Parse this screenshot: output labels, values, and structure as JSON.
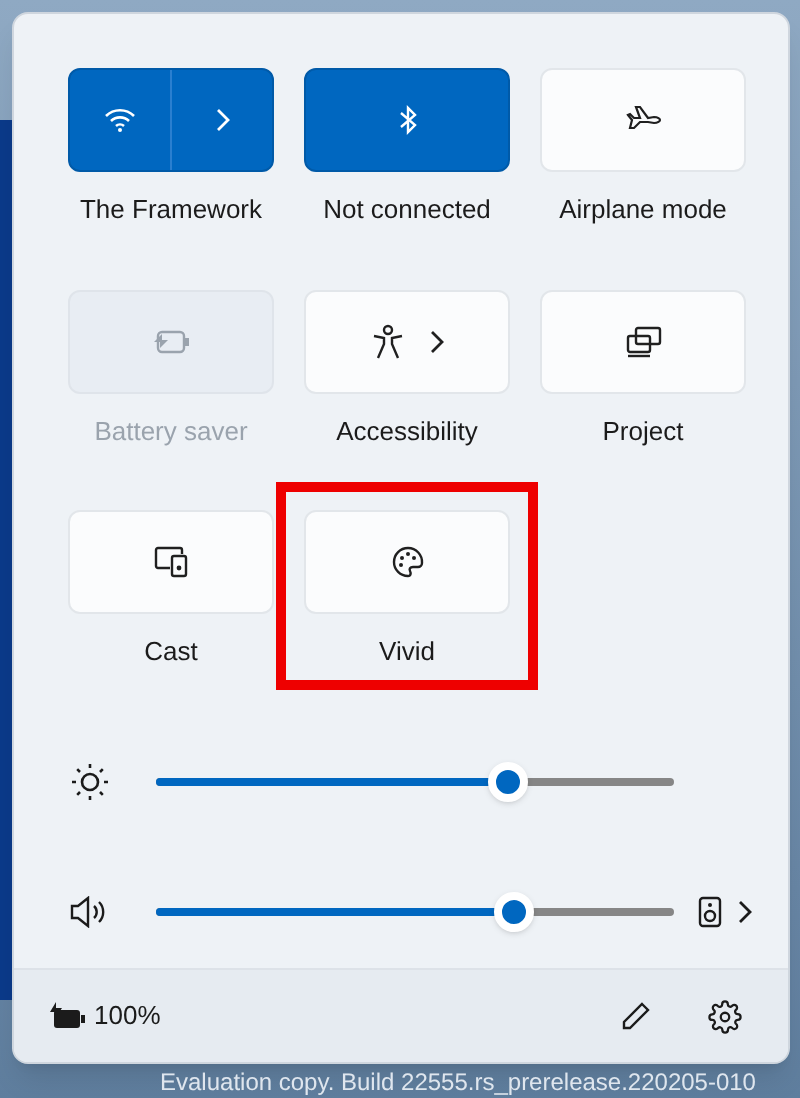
{
  "tiles": [
    {
      "label": "The Framework",
      "kind": "split",
      "on": true,
      "disabled": false,
      "highlighted": false
    },
    {
      "label": "Not connected",
      "kind": "toggle",
      "on": true,
      "disabled": false,
      "highlighted": false
    },
    {
      "label": "Airplane mode",
      "kind": "toggle",
      "on": false,
      "disabled": false,
      "highlighted": false
    },
    {
      "label": "Battery saver",
      "kind": "toggle",
      "on": false,
      "disabled": true,
      "highlighted": false
    },
    {
      "label": "Accessibility",
      "kind": "expand",
      "on": false,
      "disabled": false,
      "highlighted": false
    },
    {
      "label": "Project",
      "kind": "toggle",
      "on": false,
      "disabled": false,
      "highlighted": false
    },
    {
      "label": "Cast",
      "kind": "toggle",
      "on": false,
      "disabled": false,
      "highlighted": false
    },
    {
      "label": "Vivid",
      "kind": "toggle",
      "on": false,
      "disabled": false,
      "highlighted": true
    }
  ],
  "sliders": [
    {
      "kind": "brightness",
      "level": 0.68
    },
    {
      "kind": "volume",
      "level": 0.69
    }
  ],
  "footer": {
    "battery": "100%"
  },
  "desktop_notice": "Evaluation copy. Build 22555.rs_prerelease.220205-010"
}
